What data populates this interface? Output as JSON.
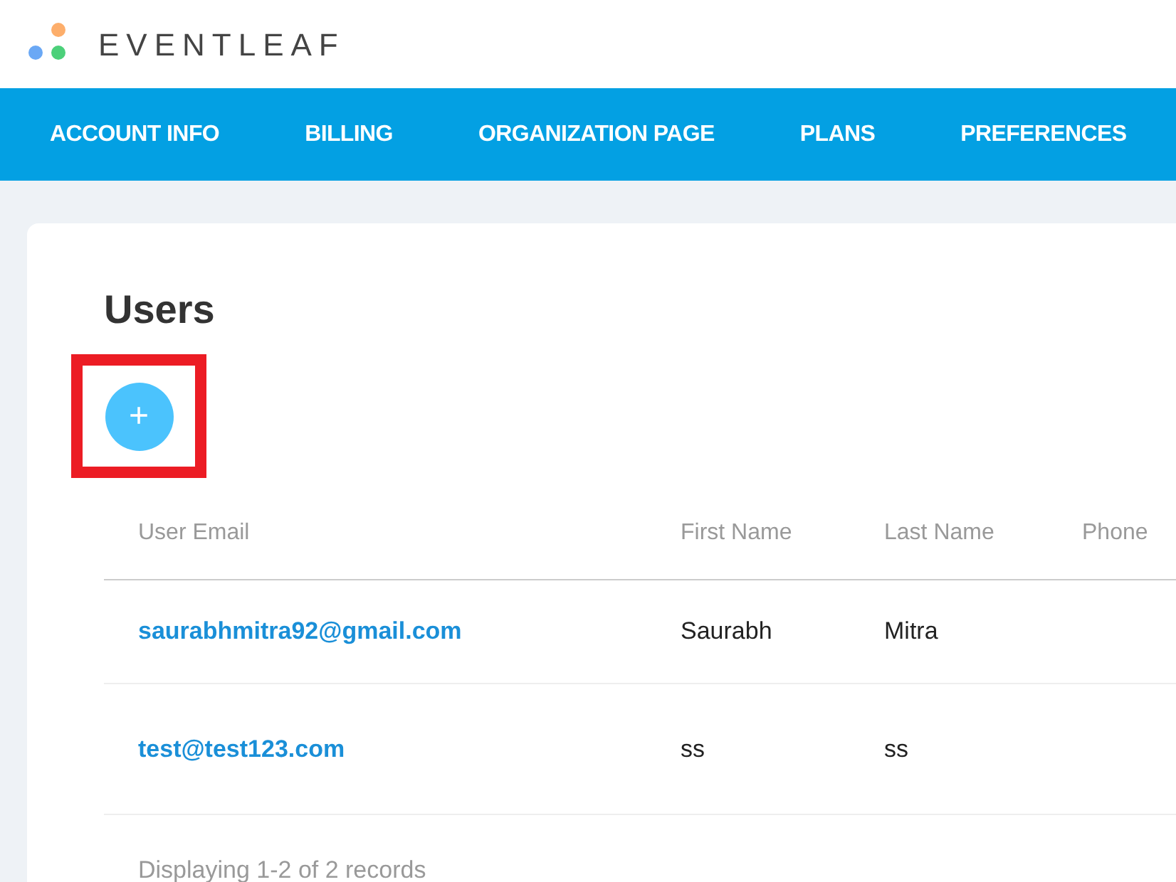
{
  "brand": {
    "name": "EVENTLEAF"
  },
  "nav": [
    {
      "label": "ACCOUNT INFO"
    },
    {
      "label": "BILLING"
    },
    {
      "label": "ORGANIZATION PAGE"
    },
    {
      "label": "PLANS"
    },
    {
      "label": "PREFERENCES"
    }
  ],
  "page": {
    "title": "Users",
    "add_button": {
      "label": "+",
      "highlighted": true
    }
  },
  "table": {
    "columns": [
      "User Email",
      "First Name",
      "Last Name",
      "Phone"
    ],
    "rows": [
      [
        "saurabhmitra92@gmail.com",
        "Saurabh",
        "Mitra",
        ""
      ],
      [
        "test@test123.com",
        "ss",
        "ss",
        ""
      ]
    ],
    "footer": "Displaying 1-2 of 2 records"
  }
}
